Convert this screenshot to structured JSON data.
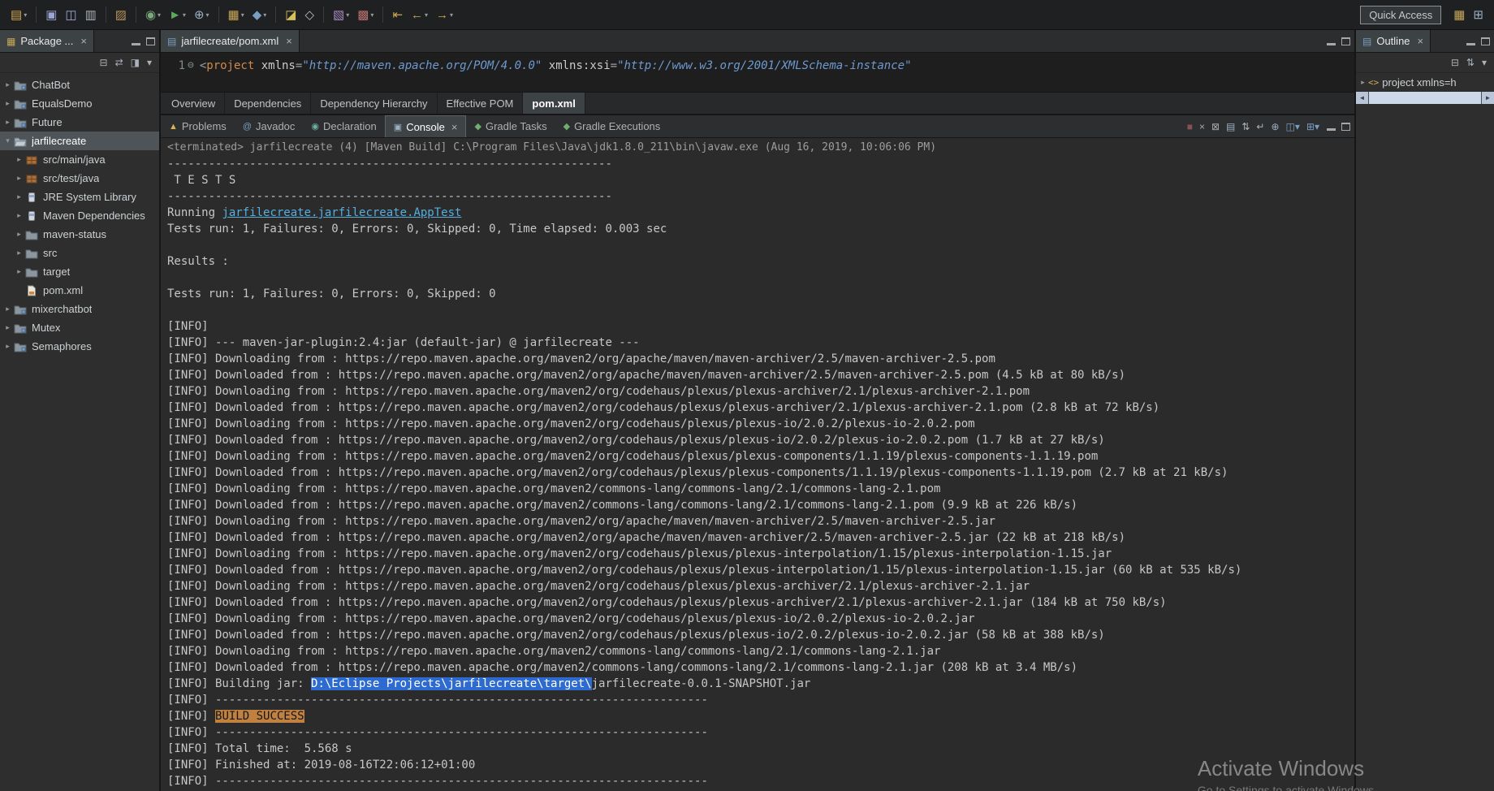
{
  "topbar": {
    "quick_access_label": "Quick Access",
    "icons": [
      {
        "name": "new-wizard-icon",
        "glyph": "▤",
        "color": "#d0a84f",
        "dropdown": true
      },
      {
        "sep": true
      },
      {
        "name": "save-icon",
        "glyph": "▣",
        "color": "#9aa5d6"
      },
      {
        "name": "save-all-icon",
        "glyph": "◫",
        "color": "#9aa5d6"
      },
      {
        "name": "print-icon",
        "glyph": "▥",
        "color": "#aab2ba"
      },
      {
        "sep": true
      },
      {
        "name": "build-all-icon",
        "glyph": "▨",
        "color": "#b8925a"
      },
      {
        "sep": true
      },
      {
        "name": "debug-icon",
        "glyph": "◉",
        "color": "#79a979",
        "dropdown": true
      },
      {
        "name": "run-icon",
        "glyph": "►",
        "color": "#5caa5c",
        "dropdown": true
      },
      {
        "name": "external-tools-icon",
        "glyph": "⊕",
        "color": "#9ab0c4",
        "dropdown": true
      },
      {
        "sep": true
      },
      {
        "name": "new-java-project-icon",
        "glyph": "▦",
        "color": "#c9a857",
        "dropdown": true
      },
      {
        "name": "new-class-icon",
        "glyph": "◆",
        "color": "#7a9ec2",
        "dropdown": true
      },
      {
        "sep": true
      },
      {
        "name": "search-icon",
        "glyph": "◪",
        "color": "#d6c05e"
      },
      {
        "name": "open-type-icon",
        "glyph": "◇",
        "color": "#b6bec6"
      },
      {
        "sep": true
      },
      {
        "name": "annotations-icon",
        "glyph": "▧",
        "color": "#a98ac0",
        "dropdown": true
      },
      {
        "name": "coverage-icon",
        "glyph": "▩",
        "color": "#bb7070",
        "dropdown": true
      },
      {
        "sep": true
      },
      {
        "name": "last-edit-location-icon",
        "glyph": "⇤",
        "color": "#d0a84f"
      },
      {
        "name": "back-icon",
        "glyph": "←",
        "color": "#d0a84f",
        "dropdown": true
      },
      {
        "name": "forward-icon",
        "glyph": "→",
        "color": "#d0a84f",
        "dropdown": true
      }
    ],
    "right_icons": [
      {
        "name": "java-perspective-icon",
        "glyph": "▦",
        "color": "#c9a857"
      },
      {
        "name": "open-perspective-icon",
        "glyph": "⊞",
        "color": "#9ab0c4"
      }
    ]
  },
  "package_explorer": {
    "title": "Package ...",
    "toolbar_icons": [
      {
        "name": "collapse-all-icon",
        "glyph": "⊟",
        "color": "#aab2ba"
      },
      {
        "name": "link-with-editor-icon",
        "glyph": "⇄",
        "color": "#aab2ba"
      },
      {
        "name": "focus-on-active-task-icon",
        "glyph": "◨",
        "color": "#aab2ba"
      },
      {
        "name": "view-menu-icon",
        "glyph": "▾",
        "color": "#aab2ba"
      }
    ],
    "tree": [
      {
        "label": "ChatBot",
        "icon": "project",
        "level": 0,
        "expander": "collapsed"
      },
      {
        "label": "EqualsDemo",
        "icon": "project",
        "level": 0,
        "expander": "collapsed"
      },
      {
        "label": "Future",
        "icon": "project",
        "level": 0,
        "expander": "collapsed"
      },
      {
        "label": "jarfilecreate",
        "icon": "project-open",
        "level": 0,
        "expander": "expanded",
        "selected": true
      },
      {
        "label": "src/main/java",
        "icon": "package",
        "level": 1,
        "expander": "collapsed"
      },
      {
        "label": "src/test/java",
        "icon": "package",
        "level": 1,
        "expander": "collapsed"
      },
      {
        "label": "JRE System Library",
        "icon": "library",
        "level": 1,
        "expander": "collapsed"
      },
      {
        "label": "Maven Dependencies",
        "icon": "library",
        "level": 1,
        "expander": "collapsed"
      },
      {
        "label": "maven-status",
        "icon": "folder",
        "level": 1,
        "expander": "collapsed"
      },
      {
        "label": "src",
        "icon": "folder",
        "level": 1,
        "expander": "collapsed"
      },
      {
        "label": "target",
        "icon": "folder",
        "level": 1,
        "expander": "collapsed"
      },
      {
        "label": "pom.xml",
        "icon": "xml-file",
        "level": 1,
        "expander": "none"
      },
      {
        "label": "mixerchatbot",
        "icon": "project",
        "level": 0,
        "expander": "collapsed"
      },
      {
        "label": "Mutex",
        "icon": "project",
        "level": 0,
        "expander": "collapsed"
      },
      {
        "label": "Semaphores",
        "icon": "project",
        "level": 0,
        "expander": "collapsed"
      }
    ]
  },
  "editor": {
    "tab_label": "jarfilecreate/pom.xml",
    "line_number": "1",
    "fold_glyph": "⊖",
    "code_segments": [
      {
        "t": "<",
        "s": "punct"
      },
      {
        "t": "project",
        "s": "tag"
      },
      {
        "t": " ",
        "s": "plain"
      },
      {
        "t": "xmlns",
        "s": "attr"
      },
      {
        "t": "=",
        "s": "punct"
      },
      {
        "t": "\"http://maven.apache.org/POM/4.0.0\"",
        "s": "val"
      },
      {
        "t": " ",
        "s": "plain"
      },
      {
        "t": "xmlns:xsi",
        "s": "attr"
      },
      {
        "t": "=",
        "s": "punct"
      },
      {
        "t": "\"http://www.w3.org/2001/XMLSchema-instance\"",
        "s": "val"
      }
    ],
    "pom_tabs": [
      "Overview",
      "Dependencies",
      "Dependency Hierarchy",
      "Effective POM",
      "pom.xml"
    ],
    "active_pom_tab": "pom.xml"
  },
  "console": {
    "tabs": [
      {
        "label": "Problems",
        "icon": "problems-icon",
        "glyph": "▲",
        "color": "#d8b450",
        "active": false
      },
      {
        "label": "Javadoc",
        "icon": "javadoc-icon",
        "glyph": "@",
        "color": "#7a9ec2",
        "active": false
      },
      {
        "label": "Declaration",
        "icon": "declaration-icon",
        "glyph": "◉",
        "color": "#6fae9f",
        "active": false
      },
      {
        "label": "Console",
        "icon": "console-icon",
        "glyph": "▣",
        "color": "#9ab0c4",
        "active": true,
        "closable": true
      },
      {
        "label": "Gradle Tasks",
        "icon": "gradle-tasks-icon",
        "glyph": "◆",
        "color": "#6fae6f",
        "active": false
      },
      {
        "label": "Gradle Executions",
        "icon": "gradle-executions-icon",
        "glyph": "◆",
        "color": "#6fae6f",
        "active": false
      }
    ],
    "toolbar_icons": [
      {
        "name": "terminate-icon",
        "glyph": "■",
        "color": "#875252"
      },
      {
        "name": "remove-launch-icon",
        "glyph": "×",
        "color": "#a8a8a8"
      },
      {
        "name": "remove-all-launches-icon",
        "glyph": "⊠",
        "color": "#a8a8a8"
      },
      {
        "name": "clear-console-icon",
        "glyph": "▤",
        "color": "#9ab0c4"
      },
      {
        "name": "scroll-lock-icon",
        "glyph": "⇅",
        "color": "#aab2ba"
      },
      {
        "name": "word-wrap-icon",
        "glyph": "↵",
        "color": "#aab2ba"
      },
      {
        "name": "pin-console-icon",
        "glyph": "⊕",
        "color": "#9ab0c4"
      },
      {
        "name": "display-selected-console-icon",
        "glyph": "◫",
        "color": "#7a9ec2",
        "dropdown": true
      },
      {
        "name": "open-console-icon",
        "glyph": "⊞",
        "color": "#7a9ec2",
        "dropdown": true
      }
    ],
    "status_line": "<terminated> jarfilecreate (4) [Maven Build] C:\\Program Files\\Java\\jdk1.8.0_211\\bin\\javaw.exe (Aug 16, 2019, 10:06:06 PM)",
    "lines": [
      "-----------------------------------------------------------------",
      " T E S T S",
      "-----------------------------------------------------------------",
      [
        {
          "t": "Running ",
          "s": "p"
        },
        {
          "t": "jarfilecreate.jarfilecreate.AppTest",
          "s": "link"
        }
      ],
      "Tests run: 1, Failures: 0, Errors: 0, Skipped: 0, Time elapsed: 0.003 sec",
      "",
      "Results :",
      "",
      "Tests run: 1, Failures: 0, Errors: 0, Skipped: 0",
      "",
      "[INFO]",
      "[INFO] --- maven-jar-plugin:2.4:jar (default-jar) @ jarfilecreate ---",
      "[INFO] Downloading from : https://repo.maven.apache.org/maven2/org/apache/maven/maven-archiver/2.5/maven-archiver-2.5.pom",
      "[INFO] Downloaded from : https://repo.maven.apache.org/maven2/org/apache/maven/maven-archiver/2.5/maven-archiver-2.5.pom (4.5 kB at 80 kB/s)",
      "[INFO] Downloading from : https://repo.maven.apache.org/maven2/org/codehaus/plexus/plexus-archiver/2.1/plexus-archiver-2.1.pom",
      "[INFO] Downloaded from : https://repo.maven.apache.org/maven2/org/codehaus/plexus/plexus-archiver/2.1/plexus-archiver-2.1.pom (2.8 kB at 72 kB/s)",
      "[INFO] Downloading from : https://repo.maven.apache.org/maven2/org/codehaus/plexus/plexus-io/2.0.2/plexus-io-2.0.2.pom",
      "[INFO] Downloaded from : https://repo.maven.apache.org/maven2/org/codehaus/plexus/plexus-io/2.0.2/plexus-io-2.0.2.pom (1.7 kB at 27 kB/s)",
      "[INFO] Downloading from : https://repo.maven.apache.org/maven2/org/codehaus/plexus/plexus-components/1.1.19/plexus-components-1.1.19.pom",
      "[INFO] Downloaded from : https://repo.maven.apache.org/maven2/org/codehaus/plexus/plexus-components/1.1.19/plexus-components-1.1.19.pom (2.7 kB at 21 kB/s)",
      "[INFO] Downloading from : https://repo.maven.apache.org/maven2/commons-lang/commons-lang/2.1/commons-lang-2.1.pom",
      "[INFO] Downloaded from : https://repo.maven.apache.org/maven2/commons-lang/commons-lang/2.1/commons-lang-2.1.pom (9.9 kB at 226 kB/s)",
      "[INFO] Downloading from : https://repo.maven.apache.org/maven2/org/apache/maven/maven-archiver/2.5/maven-archiver-2.5.jar",
      "[INFO] Downloaded from : https://repo.maven.apache.org/maven2/org/apache/maven/maven-archiver/2.5/maven-archiver-2.5.jar (22 kB at 218 kB/s)",
      "[INFO] Downloading from : https://repo.maven.apache.org/maven2/org/codehaus/plexus/plexus-interpolation/1.15/plexus-interpolation-1.15.jar",
      "[INFO] Downloaded from : https://repo.maven.apache.org/maven2/org/codehaus/plexus/plexus-interpolation/1.15/plexus-interpolation-1.15.jar (60 kB at 535 kB/s)",
      "[INFO] Downloading from : https://repo.maven.apache.org/maven2/org/codehaus/plexus/plexus-archiver/2.1/plexus-archiver-2.1.jar",
      "[INFO] Downloaded from : https://repo.maven.apache.org/maven2/org/codehaus/plexus/plexus-archiver/2.1/plexus-archiver-2.1.jar (184 kB at 750 kB/s)",
      "[INFO] Downloading from : https://repo.maven.apache.org/maven2/org/codehaus/plexus/plexus-io/2.0.2/plexus-io-2.0.2.jar",
      "[INFO] Downloaded from : https://repo.maven.apache.org/maven2/org/codehaus/plexus/plexus-io/2.0.2/plexus-io-2.0.2.jar (58 kB at 388 kB/s)",
      "[INFO] Downloading from : https://repo.maven.apache.org/maven2/commons-lang/commons-lang/2.1/commons-lang-2.1.jar",
      "[INFO] Downloaded from : https://repo.maven.apache.org/maven2/commons-lang/commons-lang/2.1/commons-lang-2.1.jar (208 kB at 3.4 MB/s)",
      [
        {
          "t": "[INFO] Building jar: ",
          "s": "p"
        },
        {
          "t": "D:\\Eclipse Projects\\jarfilecreate\\target\\",
          "s": "sel"
        },
        {
          "t": "jarfilecreate-0.0.1-SNAPSHOT.jar",
          "s": "p"
        }
      ],
      "[INFO] ------------------------------------------------------------------------",
      [
        {
          "t": "[INFO] ",
          "s": "p"
        },
        {
          "t": "BUILD SUCCESS",
          "s": "ok"
        }
      ],
      "[INFO] ------------------------------------------------------------------------",
      "[INFO] Total time:  5.568 s",
      "[INFO] Finished at: 2019-08-16T22:06:12+01:00",
      "[INFO] ------------------------------------------------------------------------"
    ]
  },
  "outline": {
    "title": "Outline",
    "toolbar_icons": [
      {
        "name": "collapse-all-icon",
        "glyph": "⊟",
        "color": "#aab2ba"
      },
      {
        "name": "sort-icon",
        "glyph": "⇅",
        "color": "#aab2ba"
      },
      {
        "name": "view-menu-icon",
        "glyph": "▾",
        "color": "#aab2ba"
      }
    ],
    "item_label": "project xmlns=h",
    "item_icon_glyph": "<>"
  },
  "watermark": {
    "line1": "Activate Windows",
    "line2": "Go to Settings to activate Windows"
  }
}
